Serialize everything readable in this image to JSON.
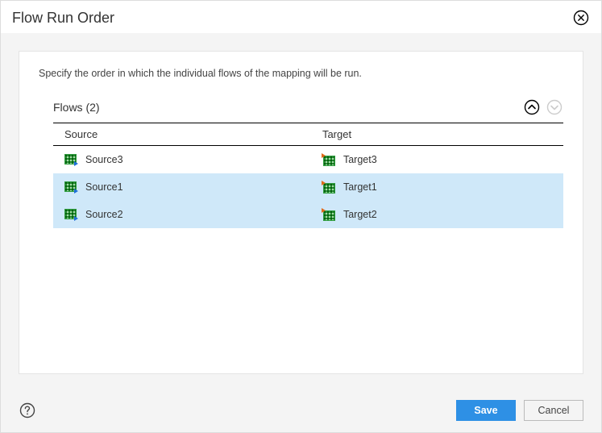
{
  "title": "Flow Run Order",
  "description": "Specify the order in which the individual flows of the mapping will be run.",
  "flows": {
    "header_label": "Flows (2)",
    "columns": {
      "source": "Source",
      "target": "Target"
    },
    "rows": [
      {
        "source": "Source3",
        "target": "Target3",
        "selected": false
      },
      {
        "source": "Source1",
        "target": "Target1",
        "selected": true
      },
      {
        "source": "Source2",
        "target": "Target2",
        "selected": true
      }
    ]
  },
  "buttons": {
    "save": "Save",
    "cancel": "Cancel"
  },
  "arrows": {
    "up_enabled": true,
    "down_enabled": false
  }
}
